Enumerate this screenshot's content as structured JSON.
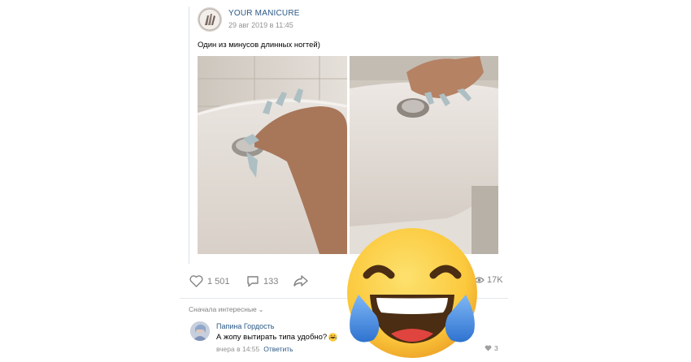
{
  "post": {
    "author": "YOUR MANICURE",
    "date": "29 авг 2019 в 11:45",
    "caption": "Один из минусов длинных ногтей)"
  },
  "actions": {
    "likes": "1 501",
    "comments": "133",
    "views": "17K"
  },
  "comments_section": {
    "sort_label": "Сначала интересные",
    "comment": {
      "author": "Папина Гордость",
      "text": "А жопу вытирать типа удобно?",
      "time": "вчера в 14:55",
      "reply_label": "Ответить",
      "likes": "3"
    }
  },
  "colors": {
    "link": "#2a5885",
    "muted": "#828282",
    "emoji_face": "#fbc93d",
    "emoji_tears": "#3f89e0"
  },
  "icons": [
    "heart-icon",
    "comment-icon",
    "share-icon",
    "eye-icon",
    "chevron-down-icon",
    "laughing-emoji-icon"
  ]
}
